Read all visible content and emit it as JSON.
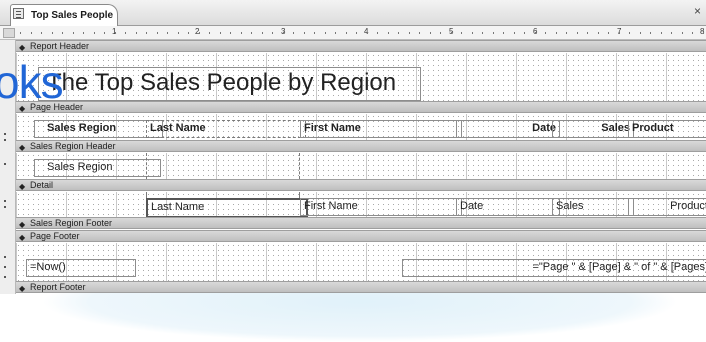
{
  "window": {
    "tab_label": "Top Sales People",
    "close_glyph": "×"
  },
  "ruler": {
    "numbers": [
      "1",
      "2",
      "3",
      "4",
      "5",
      "6",
      "7",
      "8"
    ]
  },
  "watermark": {
    "text": "oks"
  },
  "sections": {
    "report_header": "Report Header",
    "page_header": "Page Header",
    "sales_region_header": "Sales Region Header",
    "detail": "Detail",
    "sales_region_footer": "Sales Region Footer",
    "page_footer": "Page Footer",
    "report_footer": "Report Footer"
  },
  "report_header": {
    "title": "The Top Sales People by Region"
  },
  "page_header": {
    "sales_region": "Sales Region",
    "last_name": "Last Name",
    "first_name": "First Name",
    "date": "Date",
    "sales": "Sales",
    "product": "Product"
  },
  "sales_region_header": {
    "sales_region": "Sales Region"
  },
  "detail": {
    "last_name": "Last Name",
    "first_name": "First Name",
    "date": "Date",
    "sales": "Sales",
    "product": "Product"
  },
  "page_footer": {
    "now_expr": "=Now()",
    "page_expr": "=\"Page \" & [Page] & \" of \" & [Pages]"
  }
}
